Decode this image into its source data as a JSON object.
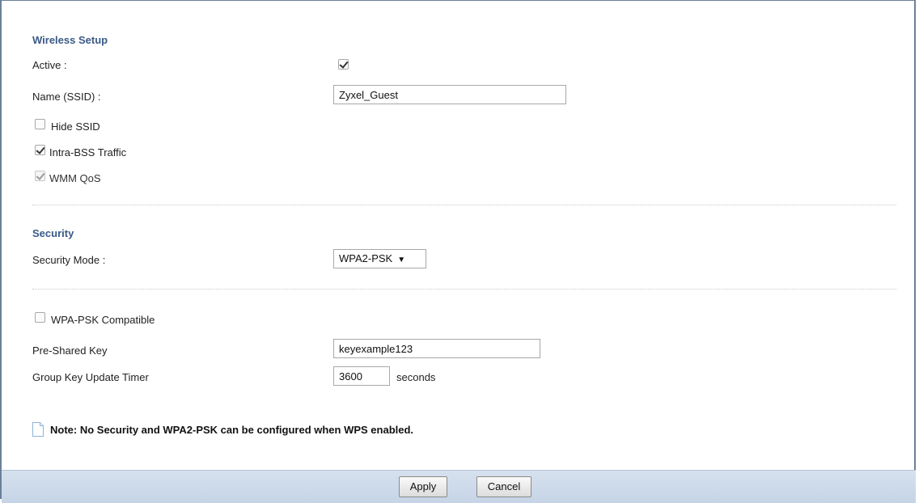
{
  "wireless_setup": {
    "title": "Wireless Setup",
    "active_label": "Active :",
    "active_checked": true,
    "ssid_label": "Name (SSID) :",
    "ssid_value": "Zyxel_Guest",
    "hide_ssid_label": "Hide SSID",
    "hide_ssid_checked": false,
    "intra_bss_label": "Intra-BSS Traffic",
    "intra_bss_checked": true,
    "wmm_qos_label": "WMM QoS",
    "wmm_qos_checked": true,
    "wmm_qos_disabled": true
  },
  "security": {
    "title": "Security",
    "mode_label": "Security Mode :",
    "mode_value": "WPA2-PSK",
    "wpa_psk_compatible_label": "WPA-PSK Compatible",
    "wpa_psk_compatible_checked": false,
    "psk_label": "Pre-Shared Key",
    "psk_value": "keyexample123",
    "group_key_label": "Group Key Update Timer",
    "group_key_value": "3600",
    "group_key_unit": "seconds"
  },
  "note": {
    "icon": "note-icon",
    "text": "Note: No Security and WPA2-PSK can be configured when WPS enabled."
  },
  "footer": {
    "apply_label": "Apply",
    "cancel_label": "Cancel"
  },
  "colors": {
    "section_title": "#3a5a86",
    "footer_bg": "#c5d4e6",
    "frame": "#6a7f99"
  }
}
